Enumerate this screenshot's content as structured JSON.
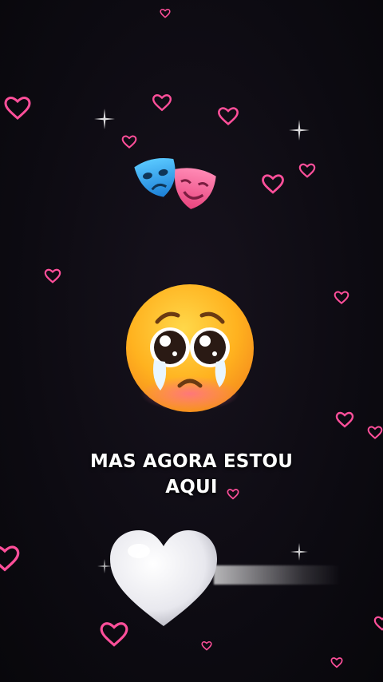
{
  "caption": {
    "line1": "MAS AGORA ESTOU",
    "line2": "AQUI"
  },
  "icons": {
    "masks": "performing-arts-icon",
    "face": "crying-face-icon",
    "heart": "white-heart-icon",
    "deco": "pink-heart-outline-icon",
    "sparkle": "sparkle-icon"
  },
  "colors": {
    "background": "#0d0b12",
    "heart_outline": "#ff4f9a",
    "caption": "#ffffff"
  }
}
